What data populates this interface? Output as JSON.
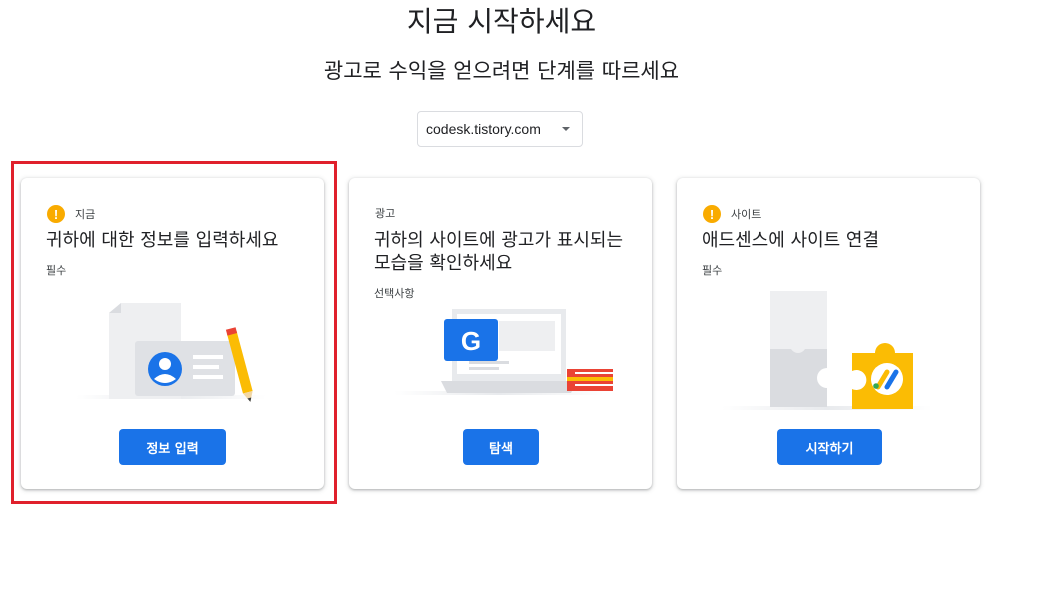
{
  "page": {
    "title": "지금 시작하세요",
    "subtitle": "광고로 수익을 얻으려면 단계를 따르세요"
  },
  "site_selector": {
    "value": "codesk.tistory.com",
    "icon": "dropdown-caret-icon"
  },
  "cards": [
    {
      "status_label": "지금",
      "status_icon": "warning-icon",
      "status_color": "#f9ab00",
      "heading": "귀하에 대한 정보를 입력하세요",
      "subtext": "필수",
      "illustration": "id-card-illustration",
      "button_label": "정보 입력",
      "highlighted": true
    },
    {
      "status_label": "광고",
      "heading": "귀하의 사이트에 광고가 표시되는 모습을 확인하세요",
      "subtext": "선택사항",
      "illustration": "laptop-google-illustration",
      "button_label": "탐색"
    },
    {
      "status_label": "사이트",
      "status_icon": "warning-icon",
      "status_color": "#f9ab00",
      "heading": "애드센스에 사이트 연결",
      "subtext": "필수",
      "illustration": "puzzle-adsense-illustration",
      "button_label": "시작하기"
    }
  ],
  "colors": {
    "primary_button": "#1a73e8",
    "warning": "#f9ab00",
    "highlight_border": "#e0202c"
  }
}
